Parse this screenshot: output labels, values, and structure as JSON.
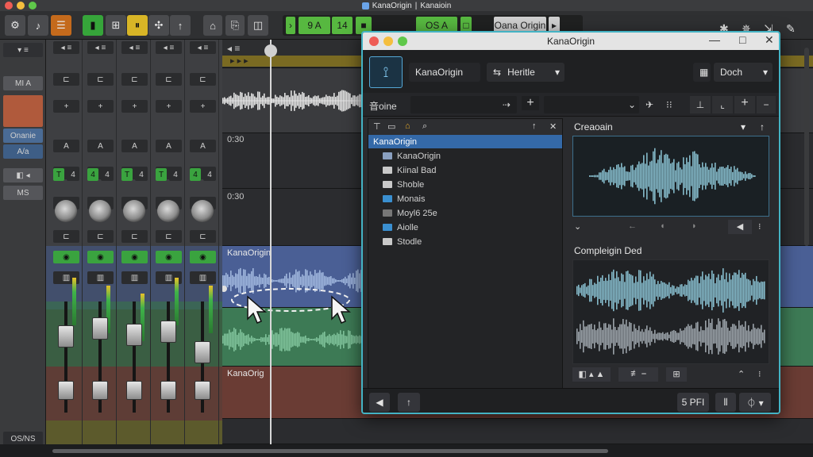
{
  "app": {
    "title": "KanaOrigin",
    "subtitle": "Kanaioin"
  },
  "toolbar": {
    "lcd_bar": "9 A",
    "lcd_beat": "14",
    "lcd_status": "OS A",
    "lcd_project": "Oana Origin"
  },
  "left_strip": {
    "items": [
      "MI A",
      "Onanie",
      "A/a",
      "MS",
      "OS/NS"
    ]
  },
  "mixer": {
    "channels": [
      {
        "fader_label": "T",
        "value": "4"
      },
      {
        "fader_label": "4",
        "value": "4"
      },
      {
        "fader_label": "T",
        "value": "4"
      },
      {
        "fader_label": "T",
        "value": "4"
      },
      {
        "fader_label": "4",
        "value": "4"
      }
    ]
  },
  "arrange": {
    "ruler_marks": [
      "0:30",
      "0:30"
    ],
    "regions": [
      {
        "label": "KanaOrigin",
        "color": "#4a5f95"
      },
      {
        "label": "KanaOrig",
        "color": "#6a3c34"
      }
    ]
  },
  "plugin": {
    "title": "KanaOrigin",
    "header": {
      "preset_name": "KanaOrigin",
      "mode_label": "Heritle",
      "view_label": "Doch"
    },
    "search_label": "音oine",
    "browser": {
      "items": [
        {
          "label": "KanaOrigin",
          "selected": true
        },
        {
          "label": "KanaOrigin",
          "folder_color": "#8aa0c0"
        },
        {
          "label": "Kiinal Bad",
          "folder_color": "#c9c9c9"
        },
        {
          "label": "Shoble",
          "folder_color": "#c9c9c9"
        },
        {
          "label": "Monais",
          "folder_color": "#3a8fd0"
        },
        {
          "label": "Moyl6 25e",
          "folder_color": "#777"
        },
        {
          "label": "Aiolle",
          "folder_color": "#3a8fd0"
        },
        {
          "label": "Stodle",
          "folder_color": "#c9c9c9"
        }
      ]
    },
    "source_panel": {
      "title": "Creaoain"
    },
    "result_panel": {
      "title": "Compleigin Ded"
    },
    "footer": {
      "rate_label": "5 PFI"
    }
  }
}
